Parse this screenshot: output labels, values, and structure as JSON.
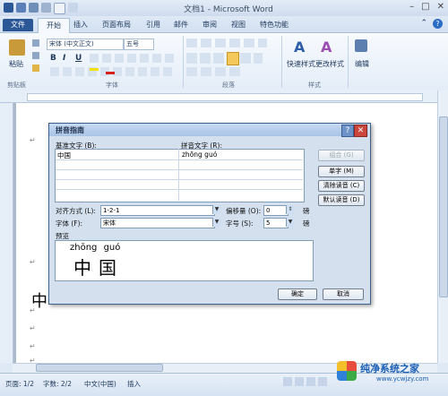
{
  "window": {
    "title": "文档1 - Microsoft Word",
    "controls": [
      "–",
      "□",
      "✕"
    ]
  },
  "tabs": {
    "file": "文件",
    "items": [
      "开始",
      "插入",
      "页面布局",
      "引用",
      "邮件",
      "审阅",
      "视图",
      "特色功能"
    ]
  },
  "ribbon": {
    "paste_label": "粘贴",
    "font_name": "宋体 (中文正文)",
    "font_size": "五号",
    "bold": "B",
    "italic": "I",
    "underline": "U",
    "group_clipboard": "剪贴板",
    "group_font": "字体",
    "group_paragraph": "段落",
    "group_styles": "样式",
    "quick_styles": "快速样式",
    "change_styles": "更改样式",
    "editing": "编辑"
  },
  "document": {
    "text": "中",
    "para_marks": [
      "↵",
      "↵",
      "↵",
      "↵",
      "↵",
      "↵"
    ]
  },
  "status": {
    "page": "页面: 1/2",
    "words": "字数: 2/2",
    "language": "中文(中国)",
    "mode": "插入",
    "zoom": "100%"
  },
  "dialog": {
    "title": "拼音指南",
    "base_text_label": "基准文字 (B):",
    "ruby_text_label": "拼音文字 (R):",
    "rows": [
      {
        "base": "中国",
        "ruby": "zhōng guó"
      },
      {
        "base": "",
        "ruby": ""
      },
      {
        "base": "",
        "ruby": ""
      },
      {
        "base": "",
        "ruby": ""
      },
      {
        "base": "",
        "ruby": ""
      }
    ],
    "buttons": {
      "group": "组合 (G)",
      "single": "单字 (M)",
      "clear": "清除读音 (C)",
      "default": "默认读音 (D)",
      "ok": "确定",
      "cancel": "取消"
    },
    "alignment_label": "对齐方式 (L):",
    "alignment_value": "1-2-1",
    "offset_label": "偏移量 (O):",
    "offset_value": "0",
    "offset_unit": "磅",
    "font_label": "字体 (F):",
    "font_value": "宋体",
    "size_label": "字号 (S):",
    "size_value": "5",
    "size_unit": "磅",
    "preview_label": "预览",
    "preview_pinyin": "zhōng guó",
    "preview_hanzi": "中国"
  },
  "watermark": {
    "text": "纯净系统之家",
    "url": "www.ycwjzy.com"
  }
}
